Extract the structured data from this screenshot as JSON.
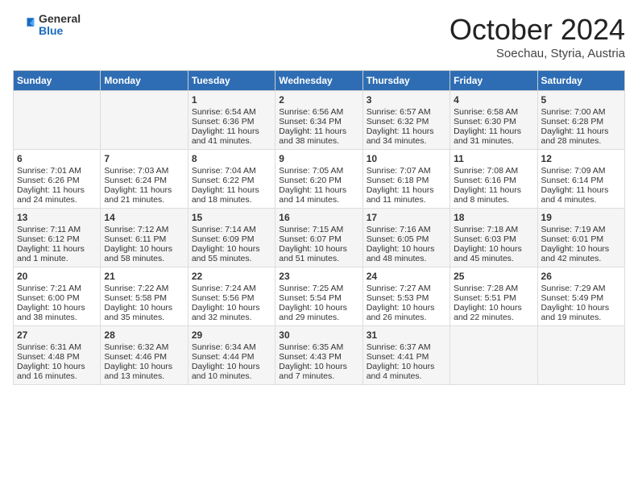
{
  "header": {
    "logo_general": "General",
    "logo_blue": "Blue",
    "title": "October 2024",
    "location": "Soechau, Styria, Austria"
  },
  "weekdays": [
    "Sunday",
    "Monday",
    "Tuesday",
    "Wednesday",
    "Thursday",
    "Friday",
    "Saturday"
  ],
  "weeks": [
    [
      {
        "day": "",
        "sunrise": "",
        "sunset": "",
        "daylight": ""
      },
      {
        "day": "",
        "sunrise": "",
        "sunset": "",
        "daylight": ""
      },
      {
        "day": "1",
        "sunrise": "Sunrise: 6:54 AM",
        "sunset": "Sunset: 6:36 PM",
        "daylight": "Daylight: 11 hours and 41 minutes."
      },
      {
        "day": "2",
        "sunrise": "Sunrise: 6:56 AM",
        "sunset": "Sunset: 6:34 PM",
        "daylight": "Daylight: 11 hours and 38 minutes."
      },
      {
        "day": "3",
        "sunrise": "Sunrise: 6:57 AM",
        "sunset": "Sunset: 6:32 PM",
        "daylight": "Daylight: 11 hours and 34 minutes."
      },
      {
        "day": "4",
        "sunrise": "Sunrise: 6:58 AM",
        "sunset": "Sunset: 6:30 PM",
        "daylight": "Daylight: 11 hours and 31 minutes."
      },
      {
        "day": "5",
        "sunrise": "Sunrise: 7:00 AM",
        "sunset": "Sunset: 6:28 PM",
        "daylight": "Daylight: 11 hours and 28 minutes."
      }
    ],
    [
      {
        "day": "6",
        "sunrise": "Sunrise: 7:01 AM",
        "sunset": "Sunset: 6:26 PM",
        "daylight": "Daylight: 11 hours and 24 minutes."
      },
      {
        "day": "7",
        "sunrise": "Sunrise: 7:03 AM",
        "sunset": "Sunset: 6:24 PM",
        "daylight": "Daylight: 11 hours and 21 minutes."
      },
      {
        "day": "8",
        "sunrise": "Sunrise: 7:04 AM",
        "sunset": "Sunset: 6:22 PM",
        "daylight": "Daylight: 11 hours and 18 minutes."
      },
      {
        "day": "9",
        "sunrise": "Sunrise: 7:05 AM",
        "sunset": "Sunset: 6:20 PM",
        "daylight": "Daylight: 11 hours and 14 minutes."
      },
      {
        "day": "10",
        "sunrise": "Sunrise: 7:07 AM",
        "sunset": "Sunset: 6:18 PM",
        "daylight": "Daylight: 11 hours and 11 minutes."
      },
      {
        "day": "11",
        "sunrise": "Sunrise: 7:08 AM",
        "sunset": "Sunset: 6:16 PM",
        "daylight": "Daylight: 11 hours and 8 minutes."
      },
      {
        "day": "12",
        "sunrise": "Sunrise: 7:09 AM",
        "sunset": "Sunset: 6:14 PM",
        "daylight": "Daylight: 11 hours and 4 minutes."
      }
    ],
    [
      {
        "day": "13",
        "sunrise": "Sunrise: 7:11 AM",
        "sunset": "Sunset: 6:12 PM",
        "daylight": "Daylight: 11 hours and 1 minute."
      },
      {
        "day": "14",
        "sunrise": "Sunrise: 7:12 AM",
        "sunset": "Sunset: 6:11 PM",
        "daylight": "Daylight: 10 hours and 58 minutes."
      },
      {
        "day": "15",
        "sunrise": "Sunrise: 7:14 AM",
        "sunset": "Sunset: 6:09 PM",
        "daylight": "Daylight: 10 hours and 55 minutes."
      },
      {
        "day": "16",
        "sunrise": "Sunrise: 7:15 AM",
        "sunset": "Sunset: 6:07 PM",
        "daylight": "Daylight: 10 hours and 51 minutes."
      },
      {
        "day": "17",
        "sunrise": "Sunrise: 7:16 AM",
        "sunset": "Sunset: 6:05 PM",
        "daylight": "Daylight: 10 hours and 48 minutes."
      },
      {
        "day": "18",
        "sunrise": "Sunrise: 7:18 AM",
        "sunset": "Sunset: 6:03 PM",
        "daylight": "Daylight: 10 hours and 45 minutes."
      },
      {
        "day": "19",
        "sunrise": "Sunrise: 7:19 AM",
        "sunset": "Sunset: 6:01 PM",
        "daylight": "Daylight: 10 hours and 42 minutes."
      }
    ],
    [
      {
        "day": "20",
        "sunrise": "Sunrise: 7:21 AM",
        "sunset": "Sunset: 6:00 PM",
        "daylight": "Daylight: 10 hours and 38 minutes."
      },
      {
        "day": "21",
        "sunrise": "Sunrise: 7:22 AM",
        "sunset": "Sunset: 5:58 PM",
        "daylight": "Daylight: 10 hours and 35 minutes."
      },
      {
        "day": "22",
        "sunrise": "Sunrise: 7:24 AM",
        "sunset": "Sunset: 5:56 PM",
        "daylight": "Daylight: 10 hours and 32 minutes."
      },
      {
        "day": "23",
        "sunrise": "Sunrise: 7:25 AM",
        "sunset": "Sunset: 5:54 PM",
        "daylight": "Daylight: 10 hours and 29 minutes."
      },
      {
        "day": "24",
        "sunrise": "Sunrise: 7:27 AM",
        "sunset": "Sunset: 5:53 PM",
        "daylight": "Daylight: 10 hours and 26 minutes."
      },
      {
        "day": "25",
        "sunrise": "Sunrise: 7:28 AM",
        "sunset": "Sunset: 5:51 PM",
        "daylight": "Daylight: 10 hours and 22 minutes."
      },
      {
        "day": "26",
        "sunrise": "Sunrise: 7:29 AM",
        "sunset": "Sunset: 5:49 PM",
        "daylight": "Daylight: 10 hours and 19 minutes."
      }
    ],
    [
      {
        "day": "27",
        "sunrise": "Sunrise: 6:31 AM",
        "sunset": "Sunset: 4:48 PM",
        "daylight": "Daylight: 10 hours and 16 minutes."
      },
      {
        "day": "28",
        "sunrise": "Sunrise: 6:32 AM",
        "sunset": "Sunset: 4:46 PM",
        "daylight": "Daylight: 10 hours and 13 minutes."
      },
      {
        "day": "29",
        "sunrise": "Sunrise: 6:34 AM",
        "sunset": "Sunset: 4:44 PM",
        "daylight": "Daylight: 10 hours and 10 minutes."
      },
      {
        "day": "30",
        "sunrise": "Sunrise: 6:35 AM",
        "sunset": "Sunset: 4:43 PM",
        "daylight": "Daylight: 10 hours and 7 minutes."
      },
      {
        "day": "31",
        "sunrise": "Sunrise: 6:37 AM",
        "sunset": "Sunset: 4:41 PM",
        "daylight": "Daylight: 10 hours and 4 minutes."
      },
      {
        "day": "",
        "sunrise": "",
        "sunset": "",
        "daylight": ""
      },
      {
        "day": "",
        "sunrise": "",
        "sunset": "",
        "daylight": ""
      }
    ]
  ]
}
